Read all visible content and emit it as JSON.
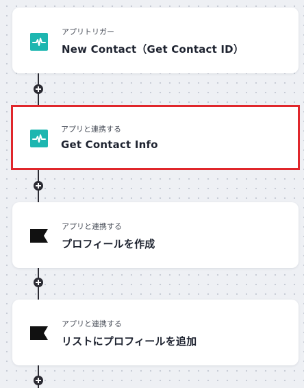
{
  "steps": [
    {
      "caption": "アプリトリガー",
      "title": "New Contact（Get Contact ID）",
      "icon": "waveform-app-icon",
      "selected": false
    },
    {
      "caption": "アプリと連携する",
      "title": "Get Contact Info",
      "icon": "waveform-app-icon",
      "selected": true
    },
    {
      "caption": "アプリと連携する",
      "title": "プロフィールを作成",
      "icon": "flag-icon",
      "selected": false
    },
    {
      "caption": "アプリと連携する",
      "title": "リストにプロフィールを追加",
      "icon": "flag-icon",
      "selected": false
    }
  ],
  "colors": {
    "selection_border": "#e0262b",
    "teal_icon": "#1db6b0",
    "connector": "#2b2b33"
  }
}
